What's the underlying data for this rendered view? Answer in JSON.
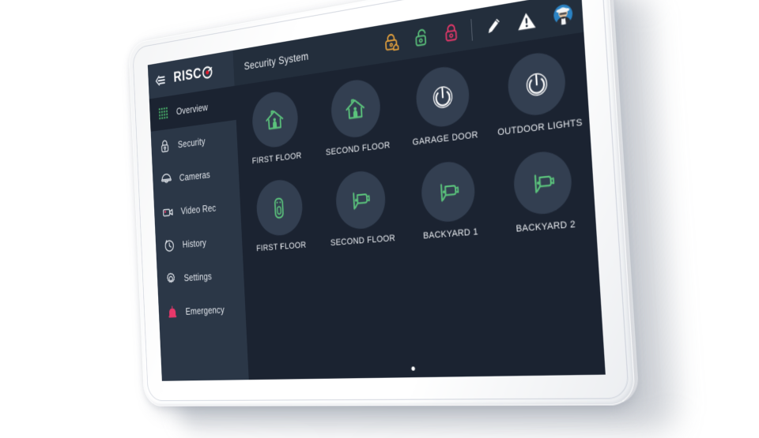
{
  "app": {
    "brand": "RISC",
    "brand_mark": "risco-target-o",
    "screen_title": "Security System"
  },
  "colors": {
    "screen_bg": "#1b2331",
    "sidebar_bg": "#2b3747",
    "topbar_bg": "#232e3c",
    "tile_bg": "#333f51",
    "accent_green": "#5bc37c",
    "accent_red": "#e8386a",
    "accent_orange": "#e8a33d",
    "text": "#eef1f5",
    "device_body": "#ffffff"
  },
  "topbar": {
    "collapse_icon": "collapse-menu-icon",
    "actions": [
      {
        "name": "partial-arm-button",
        "icon": "lock-home-icon",
        "color": "#e8a33d",
        "label": "Partial Arm"
      },
      {
        "name": "disarm-button",
        "icon": "lock-open-icon",
        "color": "#5bc37c",
        "label": "Disarm"
      },
      {
        "name": "arm-button",
        "icon": "lock-closed-icon",
        "color": "#e8386a",
        "label": "Arm"
      },
      {
        "name": "edit-button",
        "icon": "pencil-icon",
        "color": "#ffffff",
        "label": "Edit"
      },
      {
        "name": "alerts-button",
        "icon": "warning-triangle-icon",
        "color": "#ffffff",
        "label": "Alerts"
      }
    ],
    "avatar": {
      "name": "user-avatar",
      "icon": "user-avatar-icon"
    }
  },
  "sidebar": {
    "items": [
      {
        "label": "Overview",
        "icon": "grid-icon",
        "active": true
      },
      {
        "label": "Security",
        "icon": "lock-icon",
        "active": false
      },
      {
        "label": "Cameras",
        "icon": "dome-camera-icon",
        "active": false
      },
      {
        "label": "Video Rec",
        "icon": "video-rec-icon",
        "active": false
      },
      {
        "label": "History",
        "icon": "clock-icon",
        "active": false
      },
      {
        "label": "Settings",
        "icon": "gear-icon",
        "active": false
      },
      {
        "label": "Emergency",
        "icon": "siren-icon",
        "active": false
      }
    ]
  },
  "content": {
    "tiles": [
      {
        "label": "FIRST FLOOR",
        "icon": "house-person-icon",
        "color": "#5bc37c"
      },
      {
        "label": "SECOND FLOOR",
        "icon": "house-person-icon",
        "color": "#5bc37c"
      },
      {
        "label": "GARAGE DOOR",
        "icon": "power-icon",
        "color": "#ffffff"
      },
      {
        "label": "OUTDOOR LIGHTS",
        "icon": "power-icon",
        "color": "#ffffff"
      },
      {
        "label": "FIRST FLOOR",
        "icon": "detector-icon",
        "color": "#5bc37c"
      },
      {
        "label": "SECOND FLOOR",
        "icon": "cctv-camera-icon",
        "color": "#5bc37c"
      },
      {
        "label": "BACKYARD 1",
        "icon": "cctv-camera-icon",
        "color": "#5bc37c"
      },
      {
        "label": "BACKYARD 2",
        "icon": "cctv-camera-icon",
        "color": "#5bc37c"
      }
    ],
    "page_indicator": "page-dot"
  }
}
